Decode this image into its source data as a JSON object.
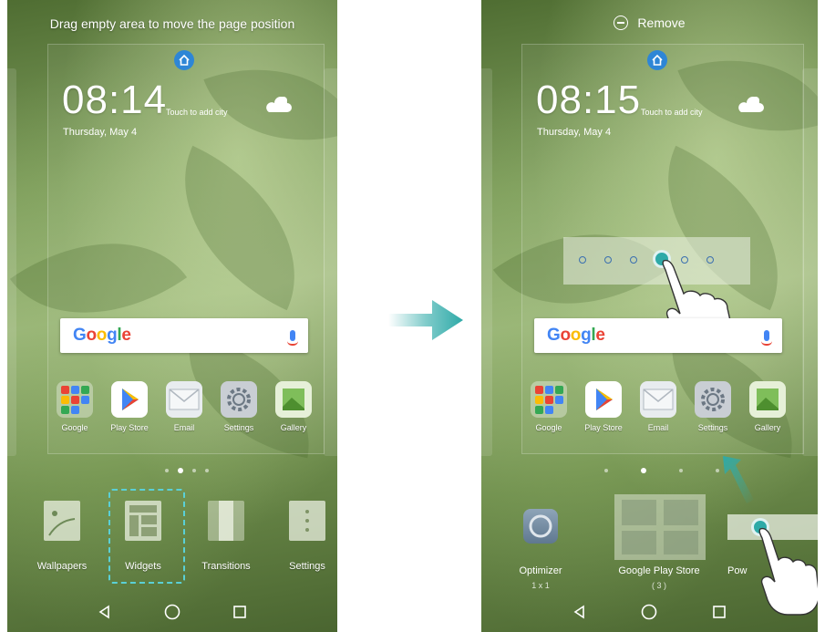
{
  "left_phone": {
    "hint": "Drag empty area to move the page position",
    "clock": "08:14",
    "touch_city": "Touch to add city",
    "date": "Thursday, May 4",
    "search_logo": "Google",
    "apps": [
      {
        "label": "Google",
        "icon": "google-folder-icon"
      },
      {
        "label": "Play Store",
        "icon": "play-store-icon"
      },
      {
        "label": "Email",
        "icon": "email-icon"
      },
      {
        "label": "Settings",
        "icon": "settings-icon"
      },
      {
        "label": "Gallery",
        "icon": "gallery-icon"
      }
    ],
    "edit_options": [
      {
        "label": "Wallpapers",
        "icon": "wallpapers-icon"
      },
      {
        "label": "Widgets",
        "icon": "widgets-icon"
      },
      {
        "label": "Transitions",
        "icon": "transitions-icon"
      },
      {
        "label": "Settings",
        "icon": "settings-dots-icon"
      }
    ],
    "page_indicator": {
      "count": 4,
      "active_index": 1
    }
  },
  "right_phone": {
    "remove_label": "Remove",
    "clock": "08:15",
    "touch_city": "Touch to add city",
    "date": "Thursday, May 4",
    "search_logo": "Google",
    "apps": [
      {
        "label": "Google",
        "icon": "google-folder-icon"
      },
      {
        "label": "Play Store",
        "icon": "play-store-icon"
      },
      {
        "label": "Email",
        "icon": "email-icon"
      },
      {
        "label": "Settings",
        "icon": "settings-icon"
      },
      {
        "label": "Gallery",
        "icon": "gallery-icon"
      }
    ],
    "widgets": [
      {
        "label": "Optimizer",
        "size": "1 x 1"
      },
      {
        "label": "Google Play Store",
        "size": "( 3 )"
      },
      {
        "label": "Pow",
        "size": ""
      }
    ],
    "page_indicator": {
      "count": 4,
      "active_index": 1
    }
  },
  "colors": {
    "accent": "#2eaaa8",
    "dashed_highlight": "#5ad0d6",
    "home_dot": "#2e86d6"
  }
}
